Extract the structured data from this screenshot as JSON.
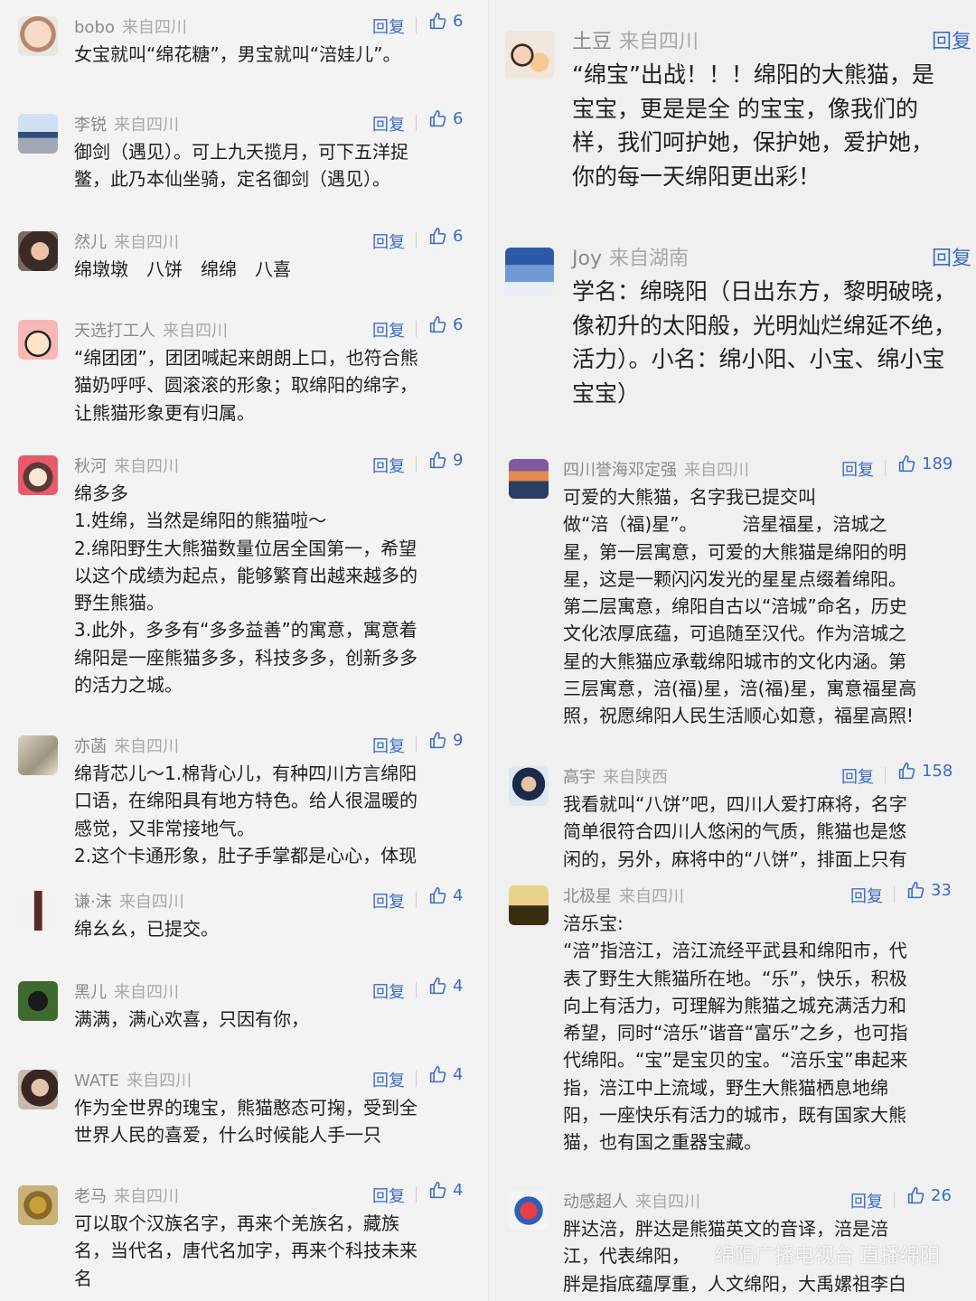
{
  "reply_label": "回复",
  "left": [
    {
      "user": "bobo",
      "loc": "来自四川",
      "likes": "6",
      "text": "女宝就叫“绵花糖”，男宝就叫“涪娃儿”。",
      "avatar": "baby-photo"
    },
    {
      "user": "李锐",
      "loc": "来自四川",
      "likes": "6",
      "text": "御剑（遇见）。可上九天揽月，可下五洋捉\n鳖，此乃本仙坐骑，定名御剑（遇见）。",
      "avatar": "landscape-photo"
    },
    {
      "user": "然儿",
      "loc": "来自四川",
      "likes": "6",
      "text": "绵墩墩　八饼　绵绵　八喜",
      "avatar": "girl-photo"
    },
    {
      "user": "天选打工人",
      "loc": "来自四川",
      "likes": "6",
      "text": "“绵团团”，团团喊起来朗朗上口，也符合熊\n猫奶呼呼、圆滚滚的形象；取绵阳的绵字，\n让熊猫形象更有归属。",
      "avatar": "cartoon-boy"
    },
    {
      "user": "秋河",
      "loc": "来自四川",
      "likes": "9",
      "text": "绵多多\n1.姓绵，当然是绵阳的熊猫啦～\n2.绵阳野生大熊猫数量位居全国第一，希望\n以这个成绩为起点，能够繁育出越来越多的\n野生熊猫。\n3.此外，多多有“多多益善”的寓意，寓意着\n绵阳是一座熊猫多多，科技多多，创新多多\n的活力之城。",
      "avatar": "cartoon-girl"
    },
    {
      "user": "亦菡",
      "loc": "来自四川",
      "likes": "9",
      "text": "绵背芯儿～1.棉背心儿，有种四川方言绵阳\n口语，在绵阳具有地方特色。给人很温暖的\n感觉，又非常接地气。\n2.这个卡通形象，肚子手掌都是心心，体现",
      "avatar": "sketch"
    },
    {
      "user": "谦·沫",
      "loc": "来自四川",
      "likes": "4",
      "text": "绵幺幺，已提交。",
      "avatar": "figure"
    },
    {
      "user": "黑儿",
      "loc": "来自四川",
      "likes": "4",
      "text": "满满，满心欢喜，只因有你，",
      "avatar": "dog-photo"
    },
    {
      "user": "WATE",
      "loc": "来自四川",
      "likes": "4",
      "text": "作为全世界的瑰宝，熊猫憨态可掬，受到全\n世界人民的喜爱，什么时候能人手一只",
      "avatar": "woman-photo"
    },
    {
      "user": "老马",
      "loc": "来自四川",
      "likes": "4",
      "text": "可以取个汉族名字，再来个羌族名，藏族\n名，当代名，唐代名加字，再来个科技未来\n名",
      "avatar": "sun-art"
    }
  ],
  "right": [
    {
      "user": "土豆",
      "loc": "来自四川",
      "likes": "",
      "text": "“绵宝”出战！！！绵阳的大熊猫，是\n宝宝，更是是全 的宝宝，像我们的\n样，我们呵护她，保护她，爱护她，\n你的每一天绵阳更出彩！",
      "avatar": "family-cartoon"
    },
    {
      "user": "Joy",
      "loc": "来自湖南",
      "likes": "",
      "text": "学名：绵晓阳（日出东方，黎明破晓，\n像初升的太阳般，光明灿烂绵延不绝，\n活力）。小名：绵小阳、小宝、绵小宝\n宝宝）",
      "avatar": "sky-photo"
    },
    {
      "user": "四川誉海邓定强",
      "loc": "来自四川",
      "likes": "189",
      "text": "可爱的大熊猫，名字我已提交叫\n做“涪（福)星”。　　　涪星福星，涪城之\n星，第一层寓意，可爱的大熊猫是绵阳的明\n星，这是一颗闪闪发光的星星点缀着绵阳。\n第二层寓意，绵阳自古以“涪城”命名，历史\n文化浓厚底蕴，可追随至汉代。作为涪城之\n星的大熊猫应承载绵阳城市的文化内涵。第\n三层寓意，涪(福)星，涪(福)星，寓意福星高\n照，祝愿绵阳人民生活顺心如意，福星高照!",
      "avatar": "mountain-photo"
    },
    {
      "user": "高宇",
      "loc": "来自陕西",
      "likes": "158",
      "text": "我看就叫“八饼”吧，四川人爱打麻将，名字\n简单很符合四川人悠闲的气质，熊猫也是悠\n闲的，另外，麻将中的“八饼”，排面上只有",
      "avatar": "man-photo"
    },
    {
      "user": "北极星",
      "loc": "来自四川",
      "likes": "33",
      "text": "涪乐宝:\n“涪”指涪江，涪江流经平武县和绵阳市，代\n表了野生大熊猫所在地。“乐”，快乐，积极\n向上有活力，可理解为熊猫之城充满活力和\n希望，同时“涪乐”谐音“富乐”之乡，也可指\n代绵阳。“宝”是宝贝的宝。“涪乐宝”串起来\n指，涪江中上流域，野生大熊猫栖息地绵\n阳，一座快乐有活力的城市，既有国家大熊\n猫，也有国之重器宝藏。",
      "avatar": "silhouette-photo"
    },
    {
      "user": "动感超人",
      "loc": "来自四川",
      "likes": "26",
      "text": "胖达涪，胖达是熊猫英文的音译，涪是涪\n江，代表绵阳，　　　　　　　\n胖是指底蕴厚重，人文绵阳，大禹嫘祖李白",
      "avatar": "cartoon-hero"
    }
  ],
  "watermark": "绵阳广播电视台 直播绵阳",
  "colors": {
    "link": "#3b6cc7",
    "meta": "#8a8a8a",
    "text": "#1f1f1f",
    "background": "#f3f3f3"
  }
}
